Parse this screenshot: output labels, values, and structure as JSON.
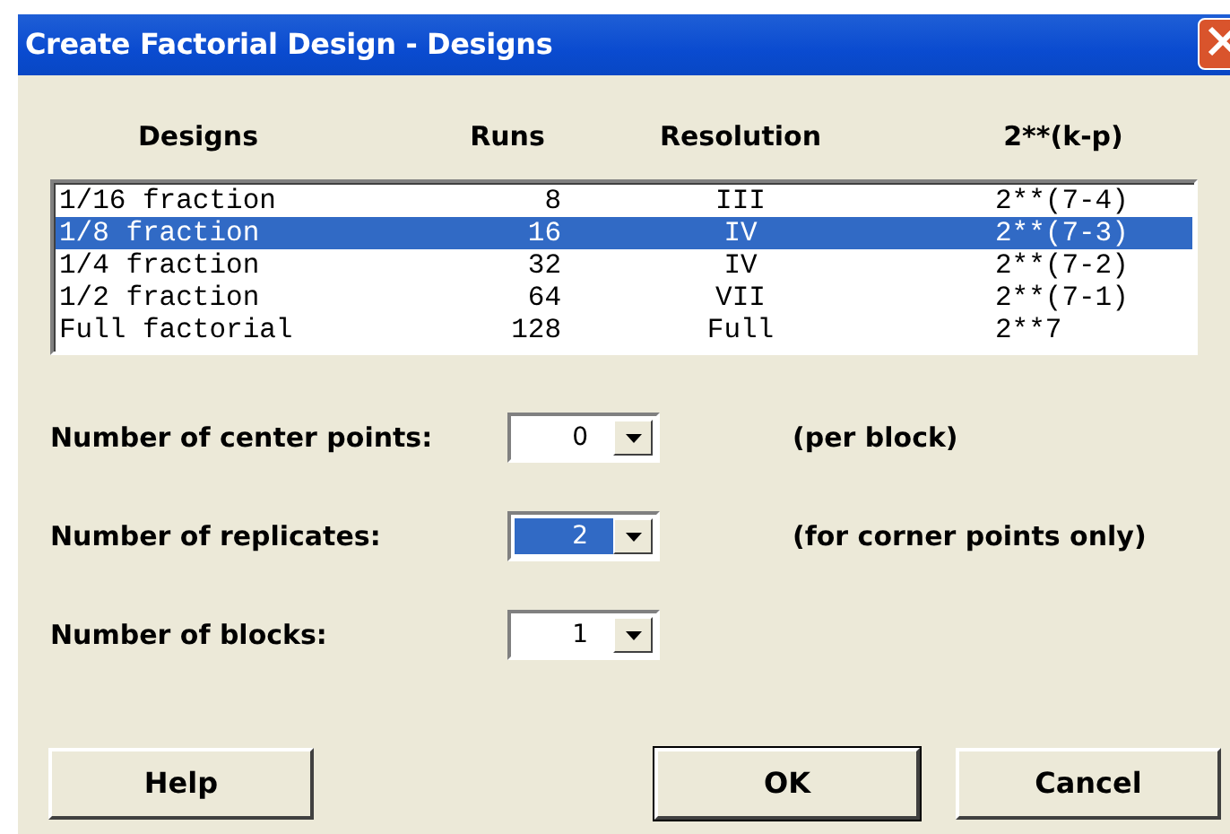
{
  "window": {
    "title": "Create Factorial Design - Designs"
  },
  "columns": [
    "Designs",
    "Runs",
    "Resolution",
    "2**(k-p)"
  ],
  "designs": [
    {
      "design": "1/16 fraction",
      "runs": "8",
      "resolution": "III",
      "formula": "2**(7-4)",
      "selected": false
    },
    {
      "design": "1/8 fraction",
      "runs": "16",
      "resolution": "IV",
      "formula": "2**(7-3)",
      "selected": true
    },
    {
      "design": "1/4 fraction",
      "runs": "32",
      "resolution": "IV",
      "formula": "2**(7-2)",
      "selected": false
    },
    {
      "design": "1/2 fraction",
      "runs": "64",
      "resolution": "VII",
      "formula": "2**(7-1)",
      "selected": false
    },
    {
      "design": "Full factorial",
      "runs": "128",
      "resolution": "Full",
      "formula": "2**7",
      "selected": false
    }
  ],
  "fields": [
    {
      "label": "Number of center points:",
      "value": "0",
      "focused": false,
      "note": "(per block)"
    },
    {
      "label": "Number of replicates:",
      "value": "2",
      "focused": true,
      "note": "(for corner points only)"
    },
    {
      "label": "Number of blocks:",
      "value": "1",
      "focused": false
    }
  ],
  "buttons": [
    {
      "label": "Help",
      "default": false
    },
    {
      "label": "OK",
      "default": true
    },
    {
      "label": "Cancel",
      "default": false
    }
  ]
}
